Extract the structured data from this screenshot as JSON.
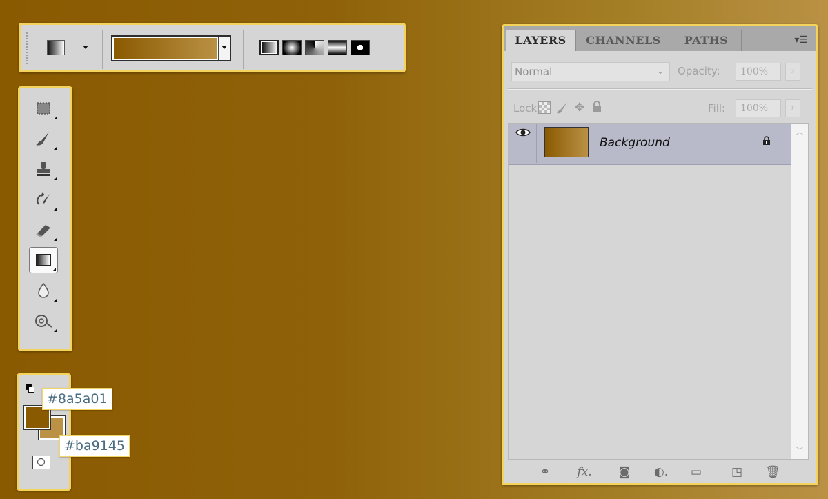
{
  "options_bar": {
    "tool_preset_icon": "gradient-tool-preset-icon",
    "preset_caret": "chevron-down-icon",
    "gradient_picker_from": "#8a5a01",
    "gradient_picker_to": "#ba9145",
    "gradient_types": [
      "linear-gradient-icon",
      "radial-gradient-icon",
      "angle-gradient-icon",
      "reflected-gradient-icon",
      "diamond-gradient-icon"
    ],
    "active_gradient_type": "linear-gradient-icon"
  },
  "tools": [
    {
      "name": "marquee-tool",
      "glyph": "⬚"
    },
    {
      "name": "brush-tool",
      "glyph": "🖌"
    },
    {
      "name": "stamp-tool",
      "glyph": "⊥"
    },
    {
      "name": "history-brush-tool",
      "glyph": "⥁"
    },
    {
      "name": "eraser-tool",
      "glyph": "◢"
    },
    {
      "name": "gradient-tool",
      "glyph": "",
      "selected": true
    },
    {
      "name": "blur-tool",
      "glyph": "💧"
    },
    {
      "name": "dodge-tool",
      "glyph": "⊙"
    }
  ],
  "colors": {
    "foreground": "#8a5a01",
    "background": "#ba9145",
    "foreground_label": "#8a5a01",
    "background_label": "#ba9145"
  },
  "layers_panel": {
    "tabs": [
      "LAYERS",
      "CHANNELS",
      "PATHS"
    ],
    "active_tab": "LAYERS",
    "blend_mode": "Normal",
    "opacity_label": "Opacity:",
    "opacity_value": "100%",
    "lock_label": "Lock:",
    "fill_label": "Fill:",
    "fill_value": "100%",
    "layers": [
      {
        "name": "Background",
        "visible": true,
        "locked": true,
        "thumb_from": "#8a5a01",
        "thumb_to": "#ba9145"
      }
    ],
    "footer_icons": [
      "link-icon",
      "fx-icon",
      "mask-icon",
      "adjustment-icon",
      "folder-icon",
      "new-layer-icon",
      "trash-icon"
    ]
  }
}
